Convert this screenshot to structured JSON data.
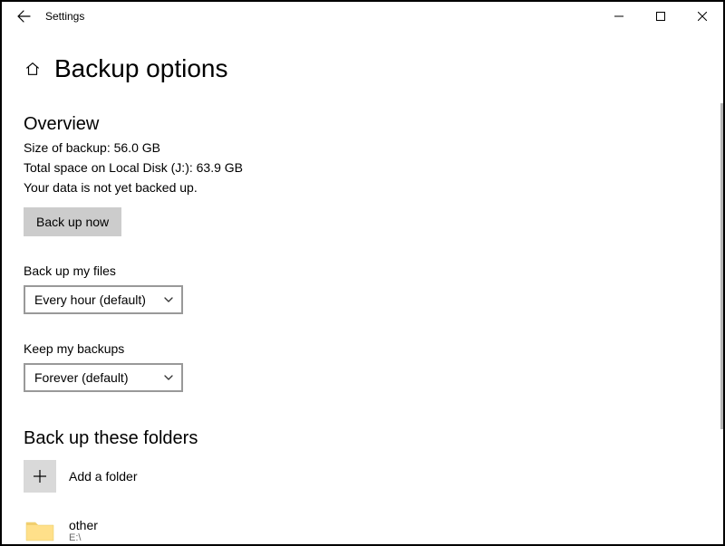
{
  "window": {
    "title": "Settings"
  },
  "page": {
    "title": "Backup options"
  },
  "overview": {
    "heading": "Overview",
    "size_line": "Size of backup: 56.0 GB",
    "space_line": "Total space on Local Disk (J:): 63.9 GB",
    "status_line": "Your data is not yet backed up.",
    "backup_button": "Back up now"
  },
  "frequency": {
    "label": "Back up my files",
    "value": "Every hour (default)"
  },
  "retention": {
    "label": "Keep my backups",
    "value": "Forever (default)"
  },
  "folders": {
    "heading": "Back up these folders",
    "add_label": "Add a folder",
    "items": [
      {
        "name": "other",
        "path": "E:\\"
      }
    ]
  }
}
